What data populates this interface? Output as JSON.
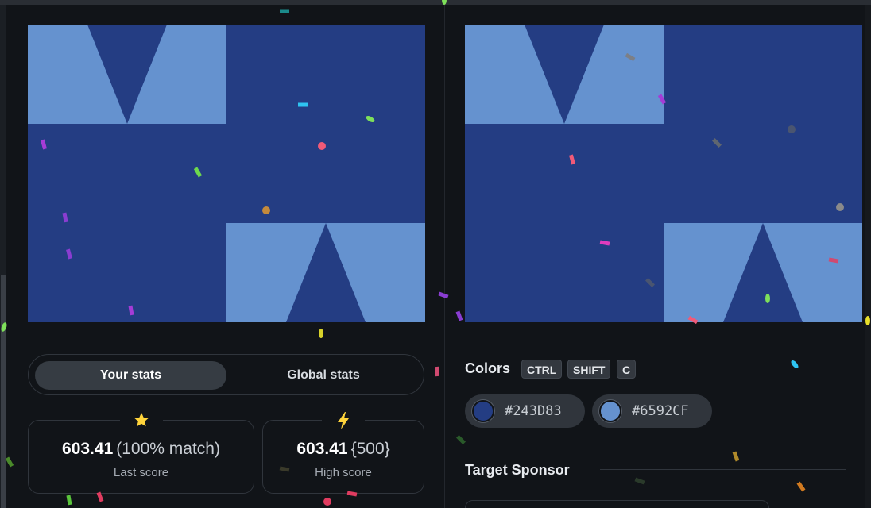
{
  "colors": {
    "dark": "#243D83",
    "light": "#6592CF",
    "background": "#111418",
    "star": "#ffd43b"
  },
  "your_canvas": {
    "name": "your-shape-canvas"
  },
  "target_canvas": {
    "name": "target-shape-canvas"
  },
  "stats_toggle": {
    "your_stats": "Your stats",
    "global_stats": "Global stats"
  },
  "last_score": {
    "value": "603.41",
    "match": "(100% match)",
    "label": "Last score",
    "icon": "star-icon"
  },
  "high_score": {
    "value": "603.41",
    "bonus": "{500}",
    "label": "High score",
    "icon": "lightning-icon"
  },
  "colors_panel": {
    "heading": "Colors",
    "shortcut": [
      "CTRL",
      "SHIFT",
      "C"
    ],
    "swatches": [
      {
        "hex": "#243D83"
      },
      {
        "hex": "#6592CF"
      }
    ]
  },
  "sponsor_panel": {
    "heading": "Target Sponsor"
  }
}
